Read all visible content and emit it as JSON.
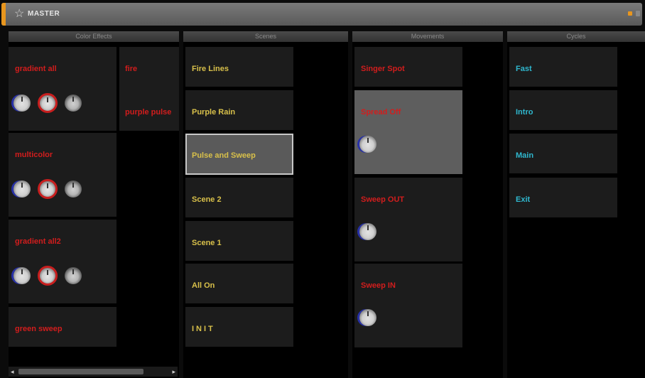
{
  "window": {
    "title": "MASTER"
  },
  "columns": {
    "color_effects": {
      "header": "Color Effects",
      "tiles": [
        {
          "label": "gradient all"
        },
        {
          "label": "multicolor"
        },
        {
          "label": "gradient all2"
        },
        {
          "label": "green sweep"
        },
        {
          "label": "fire"
        },
        {
          "label": "purple pulse"
        }
      ]
    },
    "scenes": {
      "header": "Scenes",
      "tiles": [
        {
          "label": "Fire Lines"
        },
        {
          "label": "Purple Rain"
        },
        {
          "label": "Pulse and Sweep"
        },
        {
          "label": "Scene 2"
        },
        {
          "label": "Scene 1"
        },
        {
          "label": "All On"
        },
        {
          "label": "INIT"
        }
      ]
    },
    "movements": {
      "header": "Movements",
      "tiles": [
        {
          "label": "Singer Spot"
        },
        {
          "label": "Spread Off"
        },
        {
          "label": "Sweep OUT"
        },
        {
          "label": "Sweep IN"
        }
      ]
    },
    "cycles": {
      "header": "Cycles",
      "tiles": [
        {
          "label": "Fast"
        },
        {
          "label": "Intro"
        },
        {
          "label": "Main"
        },
        {
          "label": "Exit"
        }
      ]
    }
  },
  "scrollbar": {
    "left_arrow": "◂",
    "right_arrow": "▸"
  },
  "colors": {
    "accent": "#e8961e",
    "effect_red": "#d21d1d",
    "scene_yellow": "#d8c04a",
    "cycle_cyan": "#2fb8cf",
    "knob_ring_blue": "#2730a8"
  }
}
